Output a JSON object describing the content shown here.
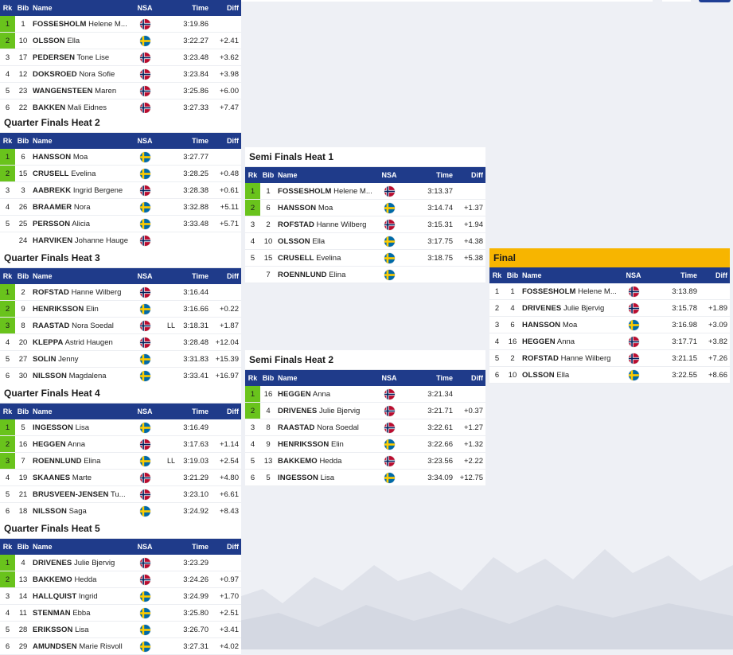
{
  "header": {
    "rank": "Rk",
    "bib": "Bib",
    "name": "Name",
    "nsa": "NSA",
    "time": "Time",
    "diff": "Diff"
  },
  "heats": [
    {
      "id": "qf1",
      "title": "",
      "rows": [
        {
          "rk": "1",
          "bib": "1",
          "last": "FOSSESHOLM",
          "first": "Helene M...",
          "nsa": "NOR",
          "note": "",
          "time": "3:19.86",
          "diff": "",
          "q": true
        },
        {
          "rk": "2",
          "bib": "10",
          "last": "OLSSON",
          "first": "Ella",
          "nsa": "SWE",
          "note": "",
          "time": "3:22.27",
          "diff": "+2.41",
          "q": true
        },
        {
          "rk": "3",
          "bib": "17",
          "last": "PEDERSEN",
          "first": "Tone Lise",
          "nsa": "NOR",
          "note": "",
          "time": "3:23.48",
          "diff": "+3.62",
          "q": false
        },
        {
          "rk": "4",
          "bib": "12",
          "last": "DOKSROED",
          "first": "Nora Sofie",
          "nsa": "NOR",
          "note": "",
          "time": "3:23.84",
          "diff": "+3.98",
          "q": false
        },
        {
          "rk": "5",
          "bib": "23",
          "last": "WANGENSTEEN",
          "first": "Maren",
          "nsa": "NOR",
          "note": "",
          "time": "3:25.86",
          "diff": "+6.00",
          "q": false
        },
        {
          "rk": "6",
          "bib": "22",
          "last": "BAKKEN",
          "first": "Mali Eidnes",
          "nsa": "NOR",
          "note": "",
          "time": "3:27.33",
          "diff": "+7.47",
          "q": false
        }
      ]
    },
    {
      "id": "qf2",
      "title": "Quarter Finals Heat 2",
      "rows": [
        {
          "rk": "1",
          "bib": "6",
          "last": "HANSSON",
          "first": "Moa",
          "nsa": "SWE",
          "note": "",
          "time": "3:27.77",
          "diff": "",
          "q": true
        },
        {
          "rk": "2",
          "bib": "15",
          "last": "CRUSELL",
          "first": "Evelina",
          "nsa": "SWE",
          "note": "",
          "time": "3:28.25",
          "diff": "+0.48",
          "q": true
        },
        {
          "rk": "3",
          "bib": "3",
          "last": "AABREKK",
          "first": "Ingrid Bergene",
          "nsa": "NOR",
          "note": "",
          "time": "3:28.38",
          "diff": "+0.61",
          "q": false
        },
        {
          "rk": "4",
          "bib": "26",
          "last": "BRAAMER",
          "first": "Nora",
          "nsa": "SWE",
          "note": "",
          "time": "3:32.88",
          "diff": "+5.11",
          "q": false
        },
        {
          "rk": "5",
          "bib": "25",
          "last": "PERSSON",
          "first": "Alicia",
          "nsa": "SWE",
          "note": "",
          "time": "3:33.48",
          "diff": "+5.71",
          "q": false
        },
        {
          "rk": "",
          "bib": "24",
          "last": "HARVIKEN",
          "first": "Johanne Hauge",
          "nsa": "NOR",
          "note": "",
          "time": "",
          "diff": "",
          "q": false
        }
      ]
    },
    {
      "id": "qf3",
      "title": "Quarter Finals Heat 3",
      "rows": [
        {
          "rk": "1",
          "bib": "2",
          "last": "ROFSTAD",
          "first": "Hanne Wilberg",
          "nsa": "NOR",
          "note": "",
          "time": "3:16.44",
          "diff": "",
          "q": true
        },
        {
          "rk": "2",
          "bib": "9",
          "last": "HENRIKSSON",
          "first": "Elin",
          "nsa": "SWE",
          "note": "",
          "time": "3:16.66",
          "diff": "+0.22",
          "q": true
        },
        {
          "rk": "3",
          "bib": "8",
          "last": "RAASTAD",
          "first": "Nora Soedal",
          "nsa": "NOR",
          "note": "LL",
          "time": "3:18.31",
          "diff": "+1.87",
          "q": true
        },
        {
          "rk": "4",
          "bib": "20",
          "last": "KLEPPA",
          "first": "Astrid Haugen",
          "nsa": "NOR",
          "note": "",
          "time": "3:28.48",
          "diff": "+12.04",
          "q": false
        },
        {
          "rk": "5",
          "bib": "27",
          "last": "SOLIN",
          "first": "Jenny",
          "nsa": "SWE",
          "note": "",
          "time": "3:31.83",
          "diff": "+15.39",
          "q": false
        },
        {
          "rk": "6",
          "bib": "30",
          "last": "NILSSON",
          "first": "Magdalena",
          "nsa": "SWE",
          "note": "",
          "time": "3:33.41",
          "diff": "+16.97",
          "q": false
        }
      ]
    },
    {
      "id": "qf4",
      "title": "Quarter Finals Heat 4",
      "rows": [
        {
          "rk": "1",
          "bib": "5",
          "last": "INGESSON",
          "first": "Lisa",
          "nsa": "SWE",
          "note": "",
          "time": "3:16.49",
          "diff": "",
          "q": true
        },
        {
          "rk": "2",
          "bib": "16",
          "last": "HEGGEN",
          "first": "Anna",
          "nsa": "NOR",
          "note": "",
          "time": "3:17.63",
          "diff": "+1.14",
          "q": true
        },
        {
          "rk": "3",
          "bib": "7",
          "last": "ROENNLUND",
          "first": "Elina",
          "nsa": "SWE",
          "note": "LL",
          "time": "3:19.03",
          "diff": "+2.54",
          "q": true
        },
        {
          "rk": "4",
          "bib": "19",
          "last": "SKAANES",
          "first": "Marte",
          "nsa": "NOR",
          "note": "",
          "time": "3:21.29",
          "diff": "+4.80",
          "q": false
        },
        {
          "rk": "5",
          "bib": "21",
          "last": "BRUSVEEN-JENSEN",
          "first": "Tu...",
          "nsa": "NOR",
          "note": "",
          "time": "3:23.10",
          "diff": "+6.61",
          "q": false
        },
        {
          "rk": "6",
          "bib": "18",
          "last": "NILSSON",
          "first": "Saga",
          "nsa": "SWE",
          "note": "",
          "time": "3:24.92",
          "diff": "+8.43",
          "q": false
        }
      ]
    },
    {
      "id": "qf5",
      "title": "Quarter Finals Heat 5",
      "rows": [
        {
          "rk": "1",
          "bib": "4",
          "last": "DRIVENES",
          "first": "Julie Bjervig",
          "nsa": "NOR",
          "note": "",
          "time": "3:23.29",
          "diff": "",
          "q": true
        },
        {
          "rk": "2",
          "bib": "13",
          "last": "BAKKEMO",
          "first": "Hedda",
          "nsa": "NOR",
          "note": "",
          "time": "3:24.26",
          "diff": "+0.97",
          "q": true
        },
        {
          "rk": "3",
          "bib": "14",
          "last": "HALLQUIST",
          "first": "Ingrid",
          "nsa": "SWE",
          "note": "",
          "time": "3:24.99",
          "diff": "+1.70",
          "q": false
        },
        {
          "rk": "4",
          "bib": "11",
          "last": "STENMAN",
          "first": "Ebba",
          "nsa": "SWE",
          "note": "",
          "time": "3:25.80",
          "diff": "+2.51",
          "q": false
        },
        {
          "rk": "5",
          "bib": "28",
          "last": "ERIKSSON",
          "first": "Lisa",
          "nsa": "SWE",
          "note": "",
          "time": "3:26.70",
          "diff": "+3.41",
          "q": false
        },
        {
          "rk": "6",
          "bib": "29",
          "last": "AMUNDSEN",
          "first": "Marie Risvoll",
          "nsa": "SWE",
          "note": "",
          "time": "3:27.31",
          "diff": "+4.02",
          "q": false
        }
      ]
    },
    {
      "id": "sf1",
      "title": "Semi Finals Heat 1",
      "rows": [
        {
          "rk": "1",
          "bib": "1",
          "last": "FOSSESHOLM",
          "first": "Helene M...",
          "nsa": "NOR",
          "note": "",
          "time": "3:13.37",
          "diff": "",
          "q": true
        },
        {
          "rk": "2",
          "bib": "6",
          "last": "HANSSON",
          "first": "Moa",
          "nsa": "SWE",
          "note": "",
          "time": "3:14.74",
          "diff": "+1.37",
          "q": true
        },
        {
          "rk": "3",
          "bib": "2",
          "last": "ROFSTAD",
          "first": "Hanne Wilberg",
          "nsa": "NOR",
          "note": "",
          "time": "3:15.31",
          "diff": "+1.94",
          "q": false
        },
        {
          "rk": "4",
          "bib": "10",
          "last": "OLSSON",
          "first": "Ella",
          "nsa": "SWE",
          "note": "",
          "time": "3:17.75",
          "diff": "+4.38",
          "q": false
        },
        {
          "rk": "5",
          "bib": "15",
          "last": "CRUSELL",
          "first": "Evelina",
          "nsa": "SWE",
          "note": "",
          "time": "3:18.75",
          "diff": "+5.38",
          "q": false
        },
        {
          "rk": "",
          "bib": "7",
          "last": "ROENNLUND",
          "first": "Elina",
          "nsa": "SWE",
          "note": "",
          "time": "",
          "diff": "",
          "q": false
        }
      ]
    },
    {
      "id": "sf2",
      "title": "Semi Finals Heat 2",
      "rows": [
        {
          "rk": "1",
          "bib": "16",
          "last": "HEGGEN",
          "first": "Anna",
          "nsa": "NOR",
          "note": "",
          "time": "3:21.34",
          "diff": "",
          "q": true
        },
        {
          "rk": "2",
          "bib": "4",
          "last": "DRIVENES",
          "first": "Julie Bjervig",
          "nsa": "NOR",
          "note": "",
          "time": "3:21.71",
          "diff": "+0.37",
          "q": true
        },
        {
          "rk": "3",
          "bib": "8",
          "last": "RAASTAD",
          "first": "Nora Soedal",
          "nsa": "NOR",
          "note": "",
          "time": "3:22.61",
          "diff": "+1.27",
          "q": false
        },
        {
          "rk": "4",
          "bib": "9",
          "last": "HENRIKSSON",
          "first": "Elin",
          "nsa": "SWE",
          "note": "",
          "time": "3:22.66",
          "diff": "+1.32",
          "q": false
        },
        {
          "rk": "5",
          "bib": "13",
          "last": "BAKKEMO",
          "first": "Hedda",
          "nsa": "NOR",
          "note": "",
          "time": "3:23.56",
          "diff": "+2.22",
          "q": false
        },
        {
          "rk": "6",
          "bib": "5",
          "last": "INGESSON",
          "first": "Lisa",
          "nsa": "SWE",
          "note": "",
          "time": "3:34.09",
          "diff": "+12.75",
          "q": false
        }
      ]
    },
    {
      "id": "final",
      "title": "Final",
      "rows": [
        {
          "rk": "1",
          "bib": "1",
          "last": "FOSSESHOLM",
          "first": "Helene M...",
          "nsa": "NOR",
          "note": "",
          "time": "3:13.89",
          "diff": "",
          "q": false
        },
        {
          "rk": "2",
          "bib": "4",
          "last": "DRIVENES",
          "first": "Julie Bjervig",
          "nsa": "NOR",
          "note": "",
          "time": "3:15.78",
          "diff": "+1.89",
          "q": false
        },
        {
          "rk": "3",
          "bib": "6",
          "last": "HANSSON",
          "first": "Moa",
          "nsa": "SWE",
          "note": "",
          "time": "3:16.98",
          "diff": "+3.09",
          "q": false
        },
        {
          "rk": "4",
          "bib": "16",
          "last": "HEGGEN",
          "first": "Anna",
          "nsa": "NOR",
          "note": "",
          "time": "3:17.71",
          "diff": "+3.82",
          "q": false
        },
        {
          "rk": "5",
          "bib": "2",
          "last": "ROFSTAD",
          "first": "Hanne Wilberg",
          "nsa": "NOR",
          "note": "",
          "time": "3:21.15",
          "diff": "+7.26",
          "q": false
        },
        {
          "rk": "6",
          "bib": "10",
          "last": "OLSSON",
          "first": "Ella",
          "nsa": "SWE",
          "note": "",
          "time": "3:22.55",
          "diff": "+8.66",
          "q": false
        }
      ]
    }
  ],
  "colors": {
    "header_bg": "#1f3b8a",
    "qualified": "#69c31c",
    "final_title_bg": "#f7b500",
    "page_bg": "#eef0f5"
  }
}
